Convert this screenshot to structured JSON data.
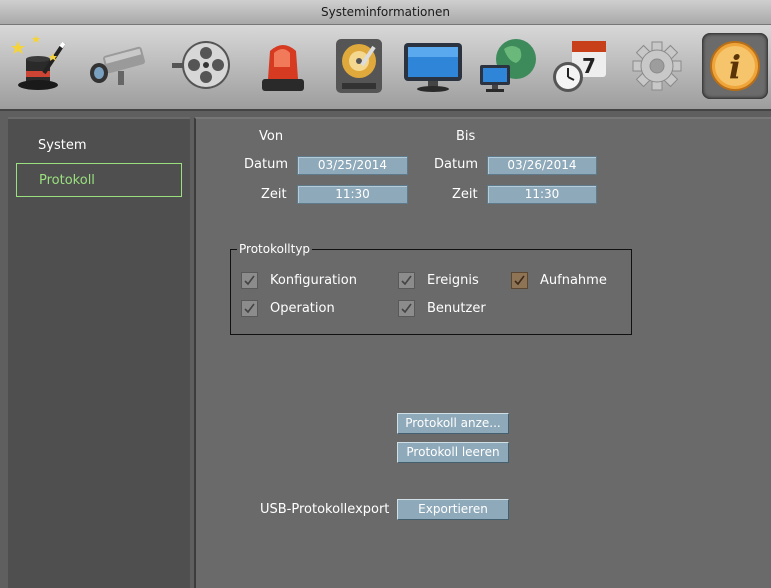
{
  "window": {
    "title": "Systeminformationen"
  },
  "toolbar": {
    "icons": [
      {
        "name": "wizard-hat-icon"
      },
      {
        "name": "camera-icon"
      },
      {
        "name": "film-reel-icon"
      },
      {
        "name": "alarm-light-icon"
      },
      {
        "name": "hard-disk-icon"
      },
      {
        "name": "monitor-icon"
      },
      {
        "name": "network-icon"
      },
      {
        "name": "schedule-icon",
        "text": "7"
      },
      {
        "name": "gear-icon"
      },
      {
        "name": "info-icon",
        "text": "i",
        "active": true
      }
    ]
  },
  "sidebar": {
    "items": [
      {
        "label": "System"
      },
      {
        "label": "Protokoll",
        "selected": true
      }
    ]
  },
  "main": {
    "von_label": "Von",
    "bis_label": "Bis",
    "von": {
      "datum_label": "Datum",
      "datum": "03/25/2014",
      "zeit_label": "Zeit",
      "zeit": "11:30"
    },
    "bis": {
      "datum_label": "Datum",
      "datum": "03/26/2014",
      "zeit_label": "Zeit",
      "zeit": "11:30"
    },
    "protokolltyp": {
      "legend": "Protokolltyp",
      "options": [
        {
          "label": "Konfiguration",
          "checked": true
        },
        {
          "label": "Ereignis",
          "checked": true
        },
        {
          "label": "Aufnahme",
          "checked": true
        },
        {
          "label": "Operation",
          "checked": true
        },
        {
          "label": "Benutzer",
          "checked": true
        }
      ]
    },
    "buttons": {
      "show_log": "Protokoll anze...",
      "clear_log": "Protokoll leeren"
    },
    "usb_export": {
      "label": "USB-Protokollexport",
      "button": "Exportieren"
    }
  },
  "colors": {
    "field_bg": "#8ea9b9",
    "selected_green": "#9ae07f",
    "aufnahme_checkbox": "#8f7355"
  }
}
